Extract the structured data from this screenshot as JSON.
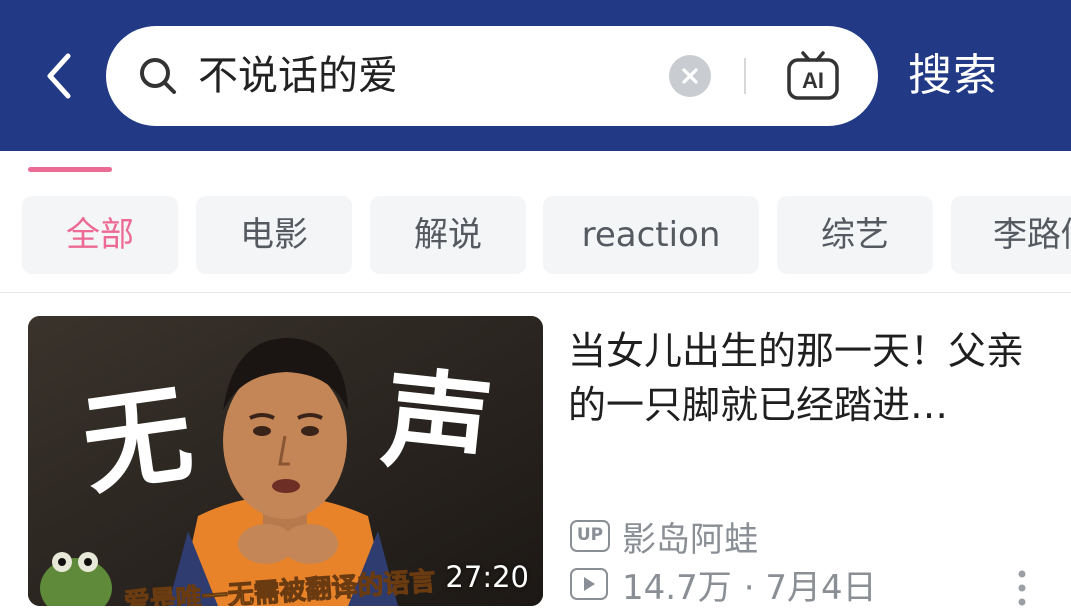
{
  "search": {
    "query": "不说话的爱",
    "submit_label": "搜索"
  },
  "icons": {
    "back": "chevron-left-icon",
    "search": "search-icon",
    "clear": "close-icon",
    "ai": "ai-tv-icon",
    "play": "play-icon",
    "more": "more-vertical-icon"
  },
  "colors": {
    "header_bg": "#223a86",
    "accent": "#ec6a93",
    "chip_bg": "#f4f5f7",
    "meta_text": "#8a8e95"
  },
  "filters": [
    {
      "label": "全部",
      "active": true
    },
    {
      "label": "电影",
      "active": false
    },
    {
      "label": "解说",
      "active": false
    },
    {
      "label": "reaction",
      "active": false
    },
    {
      "label": "综艺",
      "active": false
    },
    {
      "label": "李路修",
      "active": false
    }
  ],
  "results": [
    {
      "title": "当女儿出生的那一天！父亲的一只脚就已经踏进…",
      "thumbnail_caption": "无 声",
      "thumbnail_subtitle": "爱是唯一无需被翻译的语言",
      "duration": "27:20",
      "up_badge": "UP",
      "uploader": "影岛阿蛙",
      "views": "14.7万",
      "date": "· 7月4日"
    }
  ]
}
